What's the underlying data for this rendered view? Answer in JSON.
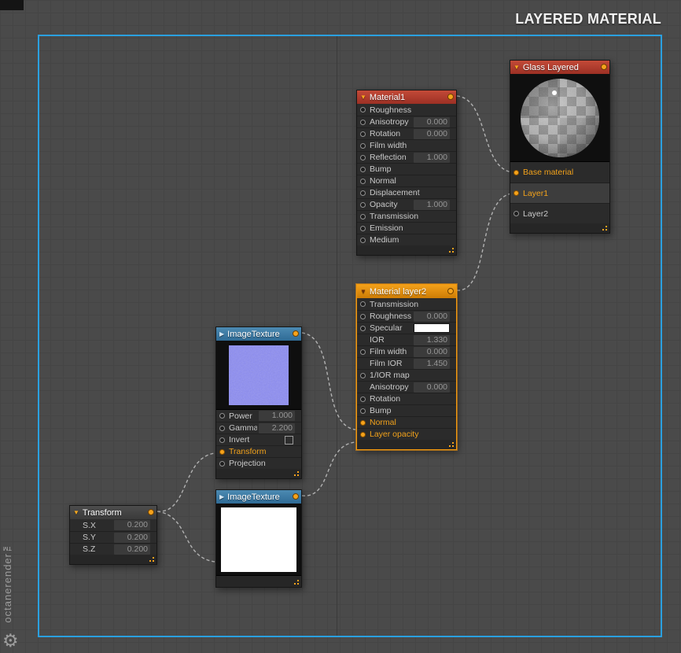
{
  "page_title": "LAYERED MATERIAL",
  "watermark": {
    "brand": "octanerender™"
  },
  "colors": {
    "accent_orange": "#f5a31c",
    "header_red": "#b13a2c",
    "header_blue": "#3d7ba6",
    "header_orange": "#e89310",
    "selection_frame_blue": "#2aa0e0",
    "wire_gray": "#c4c4c4"
  },
  "nodes": {
    "glass_layered": {
      "title": "Glass Layered",
      "collapse_icon": "▼",
      "rows": [
        {
          "label": "Base material",
          "pin": "connected",
          "orange": true
        },
        {
          "label": "Layer1",
          "pin": "connected",
          "orange": true,
          "highlight": true
        },
        {
          "label": "Layer2",
          "pin": "open"
        }
      ]
    },
    "material1": {
      "title": "Material1",
      "collapse_icon": "▼",
      "rows": [
        {
          "label": "Roughness",
          "pin": "open"
        },
        {
          "label": "Anisotropy",
          "value": "0.000",
          "pin": "open"
        },
        {
          "label": "Rotation",
          "value": "0.000",
          "pin": "open"
        },
        {
          "label": "Film width",
          "pin": "open"
        },
        {
          "label": "Reflection",
          "value": "1.000",
          "pin": "open"
        },
        {
          "label": "Bump",
          "pin": "open"
        },
        {
          "label": "Normal",
          "pin": "open"
        },
        {
          "label": "Displacement",
          "pin": "open"
        },
        {
          "label": "Opacity",
          "value": "1.000",
          "pin": "open"
        },
        {
          "label": "Transmission",
          "pin": "open"
        },
        {
          "label": "Emission",
          "pin": "open"
        },
        {
          "label": "Medium",
          "pin": "open"
        }
      ]
    },
    "material_layer2": {
      "title": "Material layer2",
      "collapse_icon": "▼",
      "selected": true,
      "rows": [
        {
          "label": "Transmission",
          "pin": "open"
        },
        {
          "label": "Roughness",
          "value": "0.000",
          "pin": "open"
        },
        {
          "label": "Specular",
          "pin": "open",
          "swatch": "#ffffff"
        },
        {
          "label": "IOR",
          "value": "1.330",
          "pin": "none"
        },
        {
          "label": "Film width",
          "value": "0.000",
          "pin": "open"
        },
        {
          "label": "Film IOR",
          "value": "1.450",
          "pin": "none"
        },
        {
          "label": "1/IOR map",
          "pin": "open"
        },
        {
          "label": "Anisotropy",
          "value": "0.000",
          "pin": "none"
        },
        {
          "label": "Rotation",
          "pin": "open"
        },
        {
          "label": "Bump",
          "pin": "open"
        },
        {
          "label": "Normal",
          "pin": "connected",
          "orange": true
        },
        {
          "label": "Layer opacity",
          "pin": "connected",
          "orange": true
        }
      ]
    },
    "image_texture_blue": {
      "title": "ImageTexture",
      "collapse_icon": "▶",
      "rows": [
        {
          "label": "Power",
          "value": "1.000",
          "pin": "open"
        },
        {
          "label": "Gamma",
          "value": "2.200",
          "pin": "open"
        },
        {
          "label": "Invert",
          "pin": "open",
          "checkbox": false
        },
        {
          "label": "Transform",
          "pin": "connected",
          "orange": true
        },
        {
          "label": "Projection",
          "pin": "open"
        }
      ]
    },
    "image_texture_white": {
      "title": "ImageTexture",
      "collapse_icon": "▶",
      "rows": []
    },
    "transform": {
      "title": "Transform",
      "collapse_icon": "▼",
      "rows": [
        {
          "label": "S.X",
          "value": "0.200",
          "pin": "none"
        },
        {
          "label": "S.Y",
          "value": "0.200",
          "pin": "none"
        },
        {
          "label": "S.Z",
          "value": "0.200",
          "pin": "none"
        }
      ]
    }
  },
  "connections": [
    {
      "from": "Material1",
      "from_port": "output",
      "to": "Glass Layered",
      "to_port": "Base material"
    },
    {
      "from": "Material layer2",
      "from_port": "output",
      "to": "Glass Layered",
      "to_port": "Layer1"
    },
    {
      "from": "ImageTexture (blue)",
      "from_port": "output",
      "to": "Material layer2",
      "to_port": "Normal"
    },
    {
      "from": "ImageTexture (white)",
      "from_port": "output",
      "to": "Material layer2",
      "to_port": "Layer opacity"
    },
    {
      "from": "Transform",
      "from_port": "output",
      "to": "ImageTexture (blue)",
      "to_port": "Transform"
    },
    {
      "from": "Transform",
      "from_port": "output",
      "to": "ImageTexture (white)",
      "to_port": "Transform"
    }
  ]
}
